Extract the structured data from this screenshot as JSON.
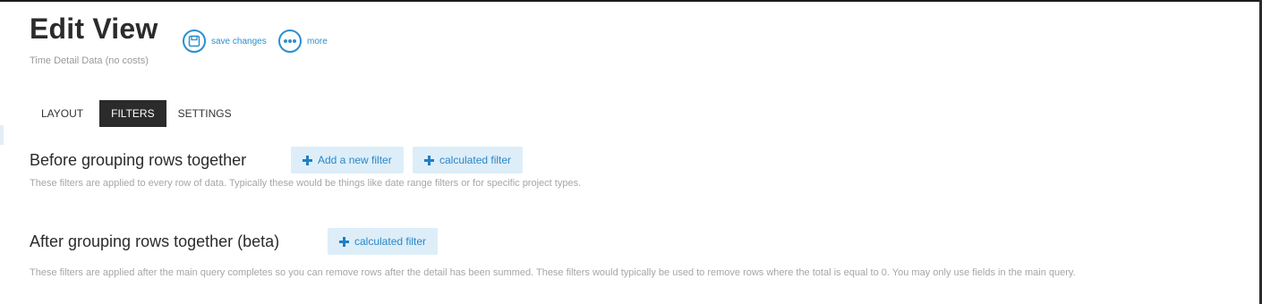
{
  "header": {
    "title": "Edit View",
    "subtitle": "Time Detail Data (no costs)"
  },
  "actions": {
    "save_label": "save changes",
    "more_label": "more"
  },
  "tabs": [
    {
      "label": "LAYOUT",
      "active": false
    },
    {
      "label": "FILTERS",
      "active": true
    },
    {
      "label": "SETTINGS",
      "active": false
    }
  ],
  "before_section": {
    "title": "Before grouping rows together",
    "add_filter_label": "Add a new filter",
    "calculated_filter_label": "calculated filter",
    "description": "These filters are applied to every row of data. Typically these would be things like date range filters or for specific project types."
  },
  "after_section": {
    "title": "After grouping rows together (beta)",
    "calculated_filter_label": "calculated filter",
    "description": "These filters are applied after the main query completes so you can remove rows after the detail has been summed. These filters would typically be used to remove rows where the total is equal to 0. You may only use fields in the main query."
  },
  "colors": {
    "accent": "#2a8fd0",
    "button_bg": "#ddeef9",
    "active_tab_bg": "#2b2b2b"
  }
}
